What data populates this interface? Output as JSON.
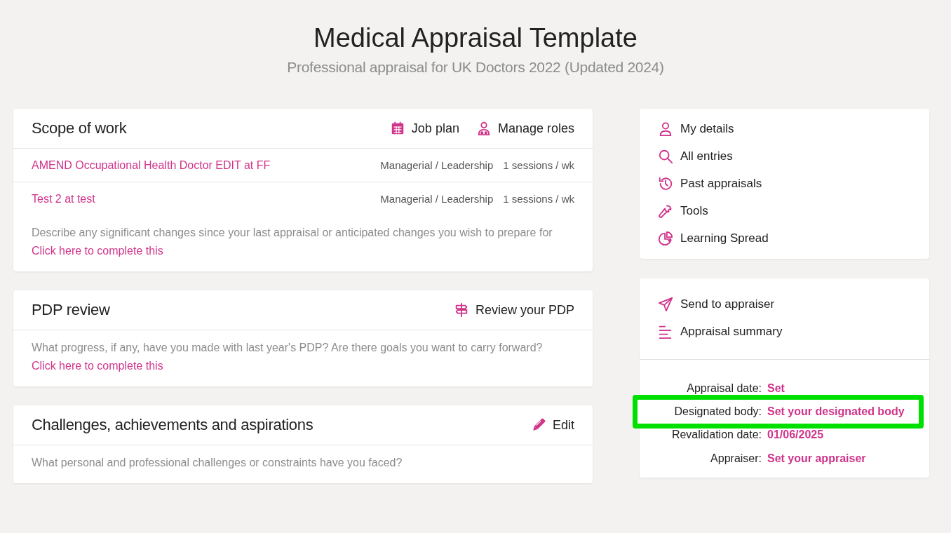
{
  "page": {
    "title": "Medical Appraisal Template",
    "subtitle": "Professional appraisal for UK Doctors 2022 (Updated 2024)"
  },
  "sections": [
    {
      "title": "Scope of work",
      "actions": [
        {
          "label": "Job plan"
        },
        {
          "label": "Manage roles"
        }
      ],
      "roles": [
        {
          "name": "AMEND Occupational Health Doctor EDIT at FF",
          "type": "Managerial / Leadership",
          "sessions": "1 sessions / wk"
        },
        {
          "name": "Test 2 at test",
          "type": "Managerial / Leadership",
          "sessions": "1 sessions / wk"
        }
      ],
      "prompt": "Describe any significant changes since your last appraisal or anticipated changes you wish to prepare for",
      "link": "Click here to complete this"
    },
    {
      "title": "PDP review",
      "actions": [
        {
          "label": "Review your PDP"
        }
      ],
      "prompt": "What progress, if any, have you made with last year's PDP? Are there goals you want to carry forward?",
      "link": "Click here to complete this"
    },
    {
      "title": "Challenges, achievements and aspirations",
      "actions": [
        {
          "label": "Edit"
        }
      ],
      "prompt": "What personal and professional challenges or constraints have you faced?"
    }
  ],
  "menu": [
    {
      "label": "My details"
    },
    {
      "label": "All entries"
    },
    {
      "label": "Past appraisals"
    },
    {
      "label": "Tools"
    },
    {
      "label": "Learning Spread"
    }
  ],
  "actions": [
    {
      "label": "Send to appraiser"
    },
    {
      "label": "Appraisal summary"
    }
  ],
  "details": [
    {
      "label": "Appraisal date:",
      "value": "Set",
      "highlighted": false
    },
    {
      "label": "Designated body:",
      "value": "Set your designated body",
      "highlighted": true
    },
    {
      "label": "Revalidation date:",
      "value": "01/06/2025",
      "highlighted": false
    },
    {
      "label": "Appraiser:",
      "value": "Set your appraiser",
      "highlighted": false
    }
  ]
}
